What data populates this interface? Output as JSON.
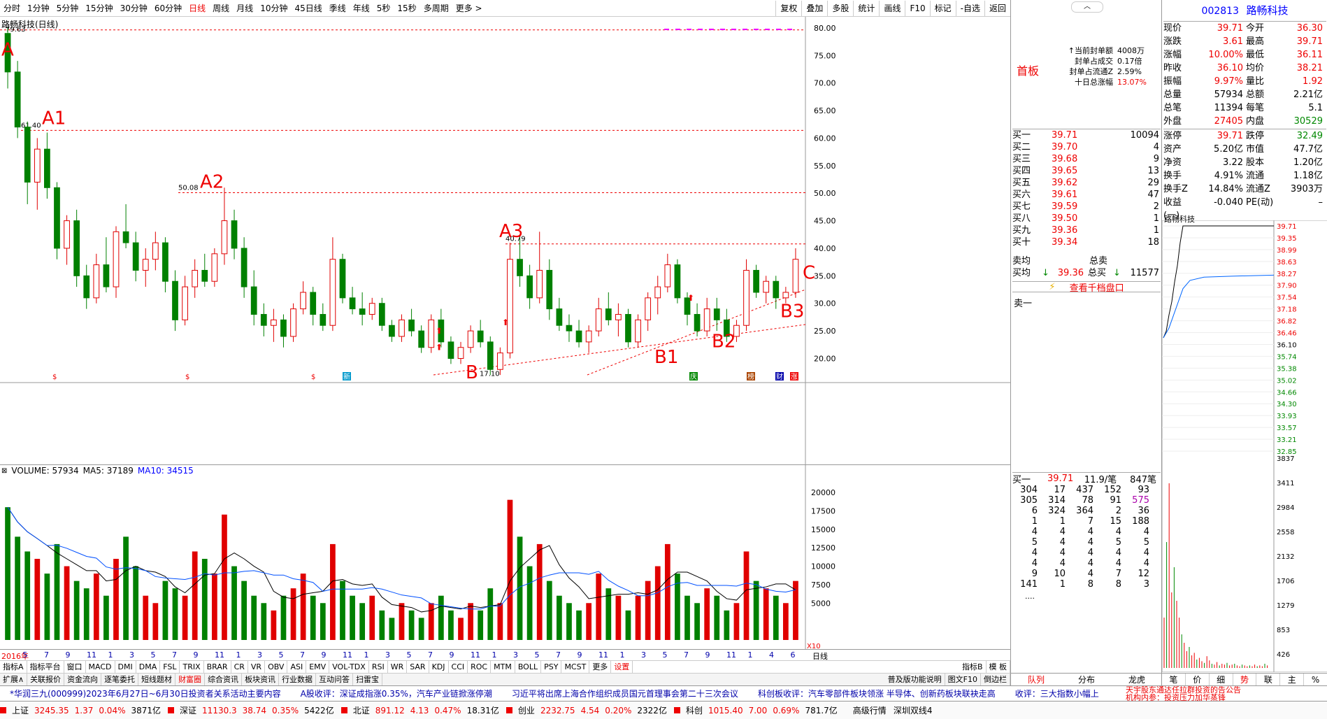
{
  "toolbar": {
    "periods": [
      "分时",
      "1分钟",
      "5分钟",
      "15分钟",
      "30分钟",
      "60分钟",
      "日线",
      "周线",
      "月线",
      "10分钟",
      "45日线",
      "季线",
      "年线",
      "5秒",
      "15秒",
      "多周期",
      "更多 >"
    ],
    "active_period": "日线",
    "right_buttons": [
      "复权",
      "叠加",
      "多股",
      "统计",
      "画线",
      "F10",
      "标记",
      "-自选",
      "返回"
    ]
  },
  "chart": {
    "title": "路畅科技(日线)",
    "max_label": "79.63",
    "min_label": "17.10",
    "price_axis": [
      "80.00",
      "75.00",
      "70.00",
      "65.00",
      "60.00",
      "55.00",
      "50.00",
      "45.00",
      "40.00",
      "35.00",
      "30.00",
      "25.00",
      "20.00"
    ],
    "annotations": {
      "A": "A",
      "A1": "A1",
      "A2": "A2",
      "A3": "A3",
      "B": "B",
      "B1": "B1",
      "B2": "B2",
      "B3": "B3",
      "C": "C"
    },
    "price_labels": {
      "a1": "61.40",
      "a2": "50.08",
      "a3": "40.79"
    },
    "candles": [
      [
        79,
        80,
        69,
        72
      ],
      [
        72,
        74,
        60,
        62
      ],
      [
        62,
        63,
        48,
        52
      ],
      [
        52,
        60,
        47,
        58
      ],
      [
        58,
        61,
        49,
        51
      ],
      [
        51,
        52,
        38,
        40
      ],
      [
        40,
        46,
        37,
        45
      ],
      [
        45,
        47,
        33,
        35
      ],
      [
        35,
        37,
        29,
        31
      ],
      [
        31,
        39,
        30,
        37
      ],
      [
        37,
        42,
        32,
        33
      ],
      [
        33,
        44,
        31,
        43
      ],
      [
        43,
        48,
        40,
        41
      ],
      [
        41,
        43,
        34,
        36
      ],
      [
        36,
        40,
        33,
        38
      ],
      [
        38,
        43,
        36,
        41
      ],
      [
        41,
        42,
        32,
        34
      ],
      [
        34,
        36,
        25,
        27
      ],
      [
        27,
        35,
        26,
        33
      ],
      [
        33,
        38,
        31,
        36
      ],
      [
        36,
        39,
        33,
        34
      ],
      [
        34,
        40,
        33,
        39
      ],
      [
        39,
        51,
        37,
        45
      ],
      [
        45,
        47,
        38,
        40
      ],
      [
        40,
        42,
        31,
        33
      ],
      [
        33,
        36,
        26,
        28
      ],
      [
        28,
        30,
        24,
        26
      ],
      [
        26,
        29,
        23,
        27
      ],
      [
        27,
        28,
        22,
        24
      ],
      [
        24,
        30,
        23,
        29
      ],
      [
        29,
        34,
        28,
        32
      ],
      [
        32,
        33,
        26,
        28
      ],
      [
        28,
        30,
        25,
        26
      ],
      [
        26,
        42,
        25,
        38
      ],
      [
        38,
        39,
        30,
        31
      ],
      [
        31,
        33,
        28,
        29
      ],
      [
        29,
        32,
        26,
        28
      ],
      [
        28,
        31,
        27,
        30
      ],
      [
        30,
        31,
        25,
        26
      ],
      [
        26,
        27,
        23,
        24
      ],
      [
        24,
        28,
        23,
        27
      ],
      [
        27,
        29,
        24,
        25
      ],
      [
        25,
        26,
        21,
        22
      ],
      [
        22,
        28,
        21,
        27
      ],
      [
        27,
        29,
        22,
        23
      ],
      [
        23,
        24,
        19,
        20
      ],
      [
        20,
        23,
        19,
        22
      ],
      [
        22,
        26,
        21,
        25
      ],
      [
        25,
        27,
        22,
        23
      ],
      [
        23,
        24,
        17,
        18
      ],
      [
        18,
        22,
        17,
        21
      ],
      [
        21,
        41,
        20,
        38
      ],
      [
        38,
        42,
        33,
        35
      ],
      [
        35,
        37,
        29,
        31
      ],
      [
        31,
        43,
        30,
        36
      ],
      [
        36,
        38,
        27,
        29
      ],
      [
        29,
        31,
        25,
        26
      ],
      [
        26,
        28,
        23,
        25
      ],
      [
        25,
        27,
        22,
        23
      ],
      [
        23,
        26,
        21,
        25
      ],
      [
        25,
        31,
        24,
        29
      ],
      [
        29,
        32,
        26,
        27
      ],
      [
        27,
        30,
        24,
        28
      ],
      [
        28,
        29,
        22,
        23
      ],
      [
        23,
        28,
        22,
        27
      ],
      [
        27,
        32,
        25,
        31
      ],
      [
        31,
        35,
        28,
        33
      ],
      [
        33,
        39,
        32,
        37
      ],
      [
        37,
        38,
        30,
        31
      ],
      [
        31,
        32,
        26,
        28
      ],
      [
        28,
        30,
        24,
        25
      ],
      [
        25,
        31,
        24,
        29
      ],
      [
        29,
        31,
        25,
        27
      ],
      [
        27,
        29,
        23,
        24
      ],
      [
        24,
        27,
        23,
        26
      ],
      [
        26,
        38,
        25,
        36
      ],
      [
        36,
        37,
        31,
        32
      ],
      [
        32,
        35,
        30,
        34
      ],
      [
        34,
        35,
        29,
        31
      ],
      [
        31,
        33,
        30,
        32
      ],
      [
        32,
        40,
        31,
        38
      ]
    ],
    "volume_label": "VOLUME: 57934",
    "ma5_label": "MA5: 37189",
    "ma10_label": "MA10: 34515",
    "volume_axis": [
      "20000",
      "17500",
      "15000",
      "12500",
      "10000",
      "7500",
      "5000"
    ],
    "x10": "X10",
    "volumes": [
      18,
      14,
      12,
      11,
      9,
      13,
      10,
      8,
      7,
      9,
      6,
      11,
      14,
      10,
      6,
      5,
      8,
      7,
      6,
      12,
      11,
      9,
      17,
      10,
      8,
      6,
      5,
      4,
      6,
      7,
      9,
      6,
      5,
      13,
      8,
      6,
      5,
      6,
      4,
      3,
      5,
      4,
      3,
      5,
      6,
      4,
      3,
      5,
      4,
      7,
      5,
      19,
      14,
      10,
      13,
      8,
      6,
      5,
      4,
      5,
      9,
      7,
      6,
      4,
      6,
      8,
      10,
      13,
      9,
      6,
      5,
      7,
      6,
      4,
      5,
      12,
      8,
      7,
      6,
      5,
      8
    ],
    "date_labels": [
      "2016年",
      "5",
      "7",
      "9",
      "11",
      "1",
      "3",
      "5",
      "7",
      "9",
      "11",
      "1",
      "3",
      "5",
      "7",
      "9",
      "11",
      "1",
      "3",
      "5",
      "7",
      "9",
      "11",
      "1",
      "3",
      "5",
      "7",
      "9",
      "11",
      "1",
      "3",
      "5",
      "7",
      "9",
      "11",
      "1",
      "4",
      "6"
    ],
    "date_right": "日线"
  },
  "indicator_tabs": {
    "row1": [
      "指标A",
      "指标平台",
      "窗口",
      "MACD",
      "DMI",
      "DMA",
      "FSL",
      "TRIX",
      "BRAR",
      "CR",
      "VR",
      "OBV",
      "ASI",
      "EMV",
      "VOL-TDX",
      "RSI",
      "WR",
      "SAR",
      "KDJ",
      "CCI",
      "ROC",
      "MTM",
      "BOLL",
      "PSY",
      "MCST",
      "更多",
      "设置"
    ],
    "row1_right": [
      "指标B",
      "模 板"
    ],
    "row2": [
      "扩展∧",
      "关联报价",
      "资金流向",
      "逐笔委托",
      "短线题材",
      "财富圈",
      "综合资讯",
      "板块资讯",
      "行业数据",
      "互动问答",
      "扫雷宝"
    ],
    "row2_right": [
      "普及版功能说明",
      "图文F10",
      "倒边栏"
    ]
  },
  "mid_panel": {
    "tag": "首板",
    "seal_lines": [
      {
        "label": "↑当前封单额",
        "value": "4008万"
      },
      {
        "label": "封单占成交",
        "value": "0.17倍"
      },
      {
        "label": "封单占流通Z",
        "value": "2.59%"
      },
      {
        "label": "十日总涨幅",
        "value": "13.07%"
      }
    ],
    "buy_levels": [
      {
        "name": "买一",
        "price": "39.71",
        "vol": "10094"
      },
      {
        "name": "买二",
        "price": "39.70",
        "vol": "4"
      },
      {
        "name": "买三",
        "price": "39.68",
        "vol": "9"
      },
      {
        "name": "买四",
        "price": "39.65",
        "vol": "13"
      },
      {
        "name": "买五",
        "price": "39.62",
        "vol": "29"
      },
      {
        "name": "买六",
        "price": "39.61",
        "vol": "47"
      },
      {
        "name": "买七",
        "price": "39.59",
        "vol": "2"
      },
      {
        "name": "买八",
        "price": "39.50",
        "vol": "1"
      },
      {
        "name": "买九",
        "price": "39.36",
        "vol": "1"
      },
      {
        "name": "买十",
        "price": "39.34",
        "vol": "18"
      }
    ],
    "sell_avg_label": "卖均",
    "total_sell_label": "总卖",
    "buy_avg_label": "买均",
    "buy_avg": "39.36",
    "total_buy_label": "总买",
    "total_buy": "11577",
    "view_book": "查看千档盘口",
    "sell_one": "卖一",
    "detail_header": {
      "name": "买一",
      "price": "39.71",
      "per": "11.9/笔",
      "count": "847笔"
    },
    "detail_rows": [
      [
        "304",
        "17",
        "437",
        "152",
        "93"
      ],
      [
        "305",
        "314",
        "78",
        "91",
        "575"
      ],
      [
        "6",
        "324",
        "364",
        "2",
        "36"
      ],
      [
        "1",
        "1",
        "7",
        "15",
        "188"
      ],
      [
        "4",
        "4",
        "4",
        "4",
        "4"
      ],
      [
        "5",
        "4",
        "4",
        "5",
        "5"
      ],
      [
        "4",
        "4",
        "4",
        "4",
        "4"
      ],
      [
        "4",
        "4",
        "4",
        "4",
        "4"
      ],
      [
        "9",
        "10",
        "4",
        "7",
        "12"
      ],
      [
        "141",
        "1",
        "8",
        "8",
        "3"
      ]
    ],
    "ellipsis": "....",
    "bottom_tabs": [
      "队列",
      "分布",
      "龙虎"
    ]
  },
  "right_panel": {
    "code": "002813",
    "name": "路畅科技",
    "quote_rows": [
      {
        "l1": "现价",
        "v1": "39.71",
        "l2": "今开",
        "v2": "36.30"
      },
      {
        "l1": "涨跌",
        "v1": "3.61",
        "l2": "最高",
        "v2": "39.71"
      },
      {
        "l1": "涨幅",
        "v1": "10.00%",
        "l2": "最低",
        "v2": "36.11"
      },
      {
        "l1": "昨收",
        "v1": "36.10",
        "l2": "均价",
        "v2": "38.21"
      },
      {
        "l1": "振幅",
        "v1": "9.97%",
        "l2": "量比",
        "v2": "1.92"
      },
      {
        "l1": "总量",
        "v1": "57934",
        "l2": "总额",
        "v2": "2.21亿"
      },
      {
        "l1": "总笔",
        "v1": "11394",
        "l2": "每笔",
        "v2": "5.1"
      },
      {
        "l1": "外盘",
        "v1": "27405",
        "l2": "内盘",
        "v2": "30529"
      }
    ],
    "stat_rows": [
      {
        "l1": "涨停",
        "v1": "39.71",
        "l2": "跌停",
        "v2": "32.49"
      },
      {
        "l1": "资产",
        "v1": "5.20亿",
        "l2": "市值",
        "v2": "47.7亿"
      },
      {
        "l1": "净资",
        "v1": "3.22",
        "l2": "股本",
        "v2": "1.20亿"
      },
      {
        "l1": "换手",
        "v1": "4.91%",
        "l2": "流通",
        "v2": "1.18亿"
      },
      {
        "l1": "换手Z",
        "v1": "14.84%",
        "l2": "流通Z",
        "v2": "3903万"
      },
      {
        "l1": "收益(一)",
        "v1": "-0.040",
        "l2": "PE(动)",
        "v2": "–"
      }
    ],
    "mini_title": "路畅科技",
    "mini_price_axis": [
      "39.71",
      "39.35",
      "38.99",
      "38.63",
      "38.27",
      "37.90",
      "37.54",
      "37.18",
      "36.82",
      "36.46",
      "36.10",
      "35.74",
      "35.38",
      "35.02",
      "34.66",
      "34.30",
      "33.93",
      "33.57",
      "33.21",
      "32.85"
    ],
    "mini_vol_axis": [
      "3837",
      "3411",
      "2984",
      "2558",
      "2132",
      "1706",
      "1279",
      "853",
      "426"
    ],
    "bottom_tabs": [
      "笔",
      "价",
      "细",
      "势",
      "联",
      "主",
      "%"
    ]
  },
  "ticker": {
    "items": [
      "*华润三九(000999)2023年6月27日~6月30日投资者关系活动主要内容",
      "A股收评：深证成指涨0.35%，汽车产业链掀涨停潮",
      "习近平将出席上海合作组织成员国元首理事会第二十三次会议",
      "科创板收评：汽车零部件板块领涨 半导体、创新药板块联袂走高",
      "收评：三大指数小幅上"
    ],
    "right_text": "天宇股东通达任拉群投资的告公告",
    "right_text2": "机构内参：投资压力加华蒸锋"
  },
  "status": {
    "items": [
      {
        "name": "上证",
        "v": "3245.35",
        "c": "1.37",
        "p": "0.04%",
        "a": "3871亿"
      },
      {
        "name": "深证",
        "v": "11130.3",
        "c": "38.74",
        "p": "0.35%",
        "a": "5422亿"
      },
      {
        "name": "北证",
        "v": "891.12",
        "c": "4.13",
        "p": "0.47%",
        "a": "18.31亿"
      },
      {
        "name": "创业",
        "v": "2232.75",
        "c": "4.54",
        "p": "0.20%",
        "a": "2322亿"
      },
      {
        "name": "科创",
        "v": "1015.40",
        "c": "7.00",
        "p": "0.69%",
        "a": "781.7亿"
      }
    ],
    "right": [
      "高级行情",
      "深圳双线4"
    ]
  },
  "colors": {
    "up": "#e00000",
    "down": "#008000",
    "ma5": "#000000",
    "ma10": "#0050ff",
    "grid": "#cccccc"
  }
}
